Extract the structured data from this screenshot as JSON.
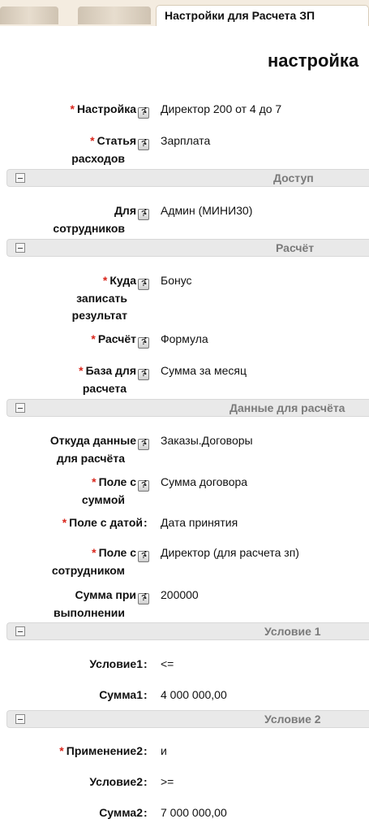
{
  "tabs": {
    "active_label": "Настройки для Расчета ЗП"
  },
  "page": {
    "title": "настройка"
  },
  "help_glyph": "?",
  "required_mark": "*",
  "colon": ":",
  "fields": {
    "setting": {
      "label": "Настройка",
      "value": "Директор 200 от 4 до 7"
    },
    "expense_1": {
      "label": "Статья"
    },
    "expense_2": {
      "label": "расходов",
      "value": "Зарплата"
    },
    "employees_1": {
      "label": "Для"
    },
    "employees_2": {
      "label": "сотрудников",
      "value": "Админ (МИНИ30)"
    },
    "where_1": {
      "label": "Куда"
    },
    "where_2": {
      "label": "записать"
    },
    "where_3": {
      "label": "результат",
      "value": "Бонус"
    },
    "calc": {
      "label": "Расчёт",
      "value": "Формула"
    },
    "base_1": {
      "label": "База для"
    },
    "base_2": {
      "label": "расчета",
      "value": "Сумма за месяц"
    },
    "source_1": {
      "label": "Откуда данные"
    },
    "source_2": {
      "label": "для расчёта",
      "value": "Заказы.Договоры"
    },
    "sumfield_1": {
      "label": "Поле с"
    },
    "sumfield_2": {
      "label": "суммой",
      "value": "Сумма договора"
    },
    "datefield": {
      "label": "Поле с датой",
      "value": "Дата принятия"
    },
    "empfield_1": {
      "label": "Поле с"
    },
    "empfield_2": {
      "label": "сотрудником",
      "value": "Директор (для расчета зп)"
    },
    "sumdone_1": {
      "label": "Сумма при"
    },
    "sumdone_2": {
      "label": "выполнении",
      "value": "200000"
    },
    "condition1": {
      "label": "Условие1",
      "value": "<="
    },
    "sum1": {
      "label": "Сумма1",
      "value": "4 000 000,00"
    },
    "apply2": {
      "label": "Применение2",
      "value": "и"
    },
    "condition2": {
      "label": "Условие2",
      "value": ">="
    },
    "sum2": {
      "label": "Сумма2",
      "value": "7 000 000,00"
    }
  },
  "sections": {
    "access": "Доступ",
    "calculation": "Расчёт",
    "data": "Данные для расчёта",
    "cond1": "Условие 1",
    "cond2": "Условие 2"
  }
}
